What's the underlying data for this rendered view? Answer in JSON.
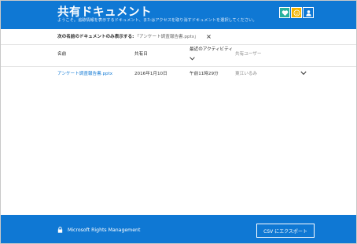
{
  "header": {
    "title": "共有ドキュメント",
    "subtitle": "ようこそ。追跡情報を表示するドキュメント、またはアクセスを取り消すドキュメントを選択してください。",
    "buttons": [
      {
        "icon": "heart-icon",
        "color": "#27b19e"
      },
      {
        "icon": "smile-icon",
        "color": "#f4b400"
      },
      {
        "icon": "person-icon",
        "color": "#0f78d4"
      }
    ]
  },
  "filter": {
    "label": "次の名前のドキュメントのみ表示する:",
    "value": "「アンケート調査報告書.pptx」"
  },
  "table": {
    "columns": {
      "name": "名前",
      "shared_date": "共有日",
      "last_activity": "最近のアクティビティ",
      "shared_users": "共有ユーザー"
    },
    "rows": [
      {
        "name": "アンケート調査報告書.pptx",
        "shared_date": "2016年1月10日",
        "last_activity": "午前11時29分",
        "shared_users": "東江いるみ"
      }
    ]
  },
  "footer": {
    "brand": "Microsoft Rights Management",
    "export_label": "CSV にエクスポート"
  },
  "colors": {
    "accent": "#0f78d4",
    "link": "#0f78d4"
  }
}
